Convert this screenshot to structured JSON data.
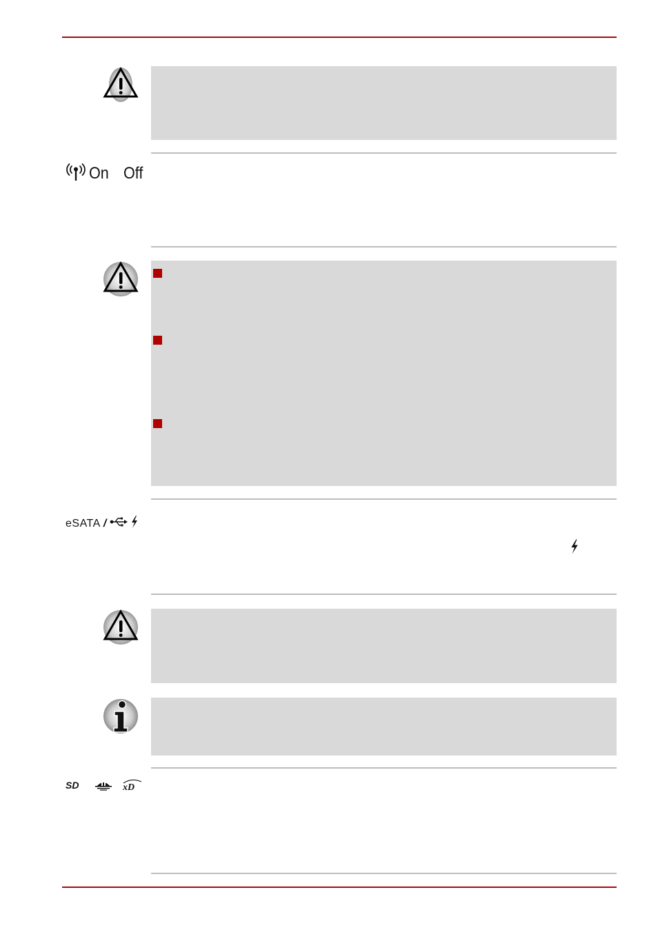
{
  "page": {
    "accent_color": "#a50a0a",
    "box_color": "#d9d9d9",
    "divider_color": "#bdbdbd",
    "bullet_color": "#b00000"
  },
  "sections": [
    {
      "type": "caution-note",
      "icon": "caution-icon",
      "bullets": 0
    },
    {
      "type": "feature-row",
      "label_icon": "wireless-antenna-icon",
      "label_parts": [
        "On",
        "Off"
      ]
    },
    {
      "type": "caution-note",
      "icon": "caution-icon",
      "bullets": 3
    },
    {
      "type": "feature-row",
      "label_text": "eSATA",
      "label_separator": "/",
      "label_icons": [
        "usb-icon",
        "lightning-icon"
      ],
      "inline_icon": "lightning-icon"
    },
    {
      "type": "caution-note",
      "icon": "caution-icon",
      "bullets": 0
    },
    {
      "type": "info-note",
      "icon": "info-icon",
      "bullets": 0
    },
    {
      "type": "feature-row",
      "label_icons": [
        "sd-card-logo-icon",
        "memory-stick-logo-icon",
        "xd-card-logo-icon"
      ]
    }
  ],
  "wireless": {
    "on_label": "On",
    "off_label": "Off"
  },
  "esata": {
    "label": "eSATA",
    "separator": "/"
  }
}
